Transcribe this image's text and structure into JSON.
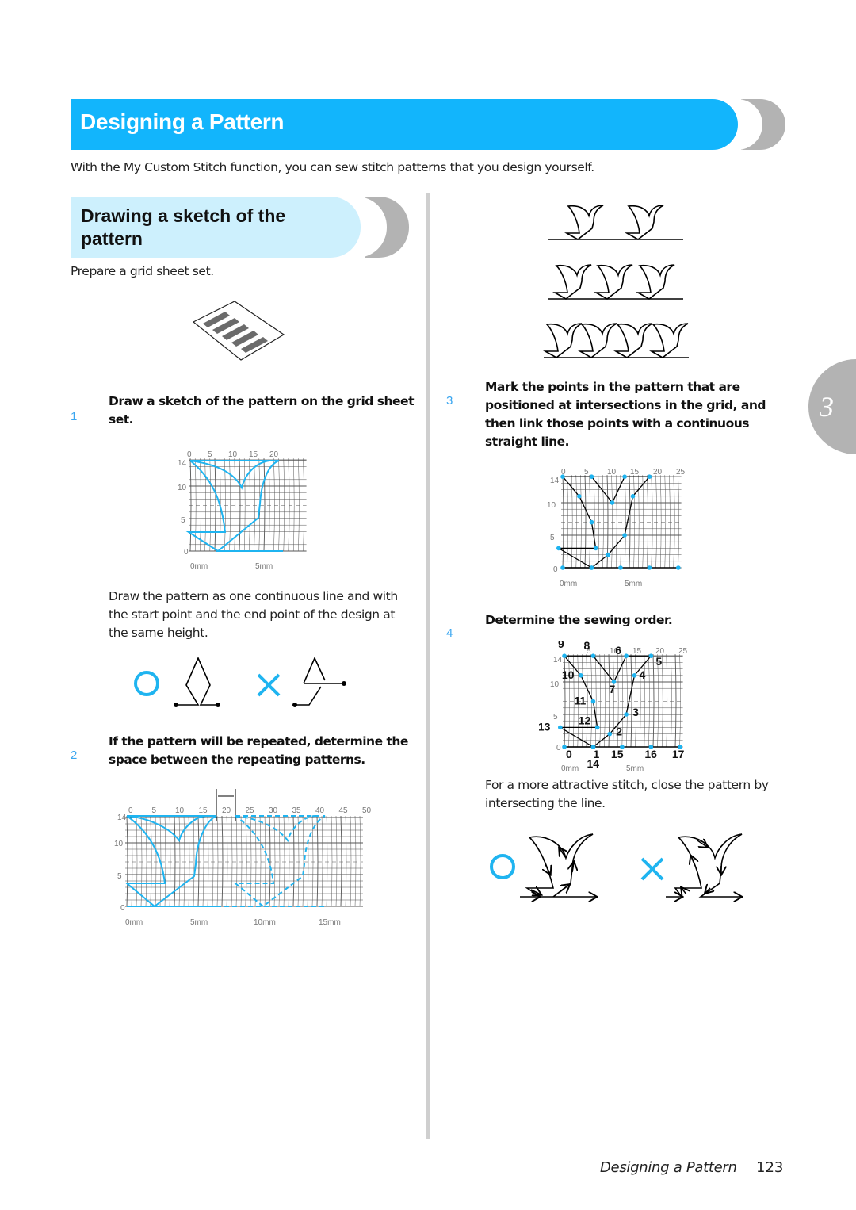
{
  "header": {
    "title": "Designing a Pattern",
    "intro": "With the My Custom Stitch function, you can sew stitch patterns that you design yourself.",
    "accent_color": "#12b5fc",
    "section_color": "#cdf0fd",
    "cap_color": "#b3b3b3"
  },
  "section": {
    "title": "Drawing a sketch of the pattern",
    "prepare": "Prepare a grid sheet set."
  },
  "steps": [
    {
      "number": "1",
      "text": "Draw a sketch of the pattern on the grid sheet set."
    },
    {
      "number": "2",
      "text": "If the pattern will be repeated, determine the space between the repeating patterns."
    },
    {
      "number": "3",
      "text": "Mark the points in the pattern that are positioned at intersections in the grid, and then link those points with a continuous straight line."
    },
    {
      "number": "4",
      "text": "Determine the sewing order."
    }
  ],
  "notes": {
    "continuous_line": "Draw the pattern as one continuous line and with the start point and the end point of the design at the same height.",
    "close_pattern": "For a more attractive stitch, close the pattern by intersecting the line."
  },
  "symbols": {
    "ok": "circle-ok-icon",
    "ng": "cross-ng-icon",
    "ok_color": "#1fb4f0",
    "line_color": "#000000"
  },
  "grid1": {
    "x_ticks": [
      "0",
      "5",
      "10",
      "15",
      "20"
    ],
    "y_ticks": [
      "14",
      "10",
      "5",
      "0"
    ],
    "mm_labels": [
      "0mm",
      "5mm"
    ]
  },
  "grid2": {
    "x_ticks": [
      "0",
      "5",
      "10",
      "15",
      "20",
      "25",
      "30",
      "35",
      "40",
      "45",
      "50"
    ],
    "y_ticks": [
      "14",
      "10",
      "5",
      "0"
    ],
    "mm_labels": [
      "0mm",
      "5mm",
      "10mm",
      "15mm"
    ]
  },
  "grid3": {
    "x_ticks": [
      "0",
      "5",
      "10",
      "15",
      "20",
      "25"
    ],
    "y_ticks": [
      "14",
      "10",
      "5",
      "0"
    ],
    "mm_labels": [
      "0mm",
      "5mm"
    ]
  },
  "grid4": {
    "x_ticks": [
      "5",
      "10",
      "15",
      "20",
      "25"
    ],
    "y_ticks": [
      "14",
      "10",
      "5",
      "0"
    ],
    "mm_labels": [
      "0mm",
      "5mm"
    ],
    "order_labels": [
      "0",
      "1",
      "2",
      "3",
      "4",
      "5",
      "6",
      "7",
      "8",
      "9",
      "10",
      "11",
      "12",
      "13",
      "14",
      "15",
      "16",
      "17"
    ]
  },
  "chapter": {
    "number": "3"
  },
  "footer": {
    "title": "Designing a Pattern",
    "page": "123"
  }
}
